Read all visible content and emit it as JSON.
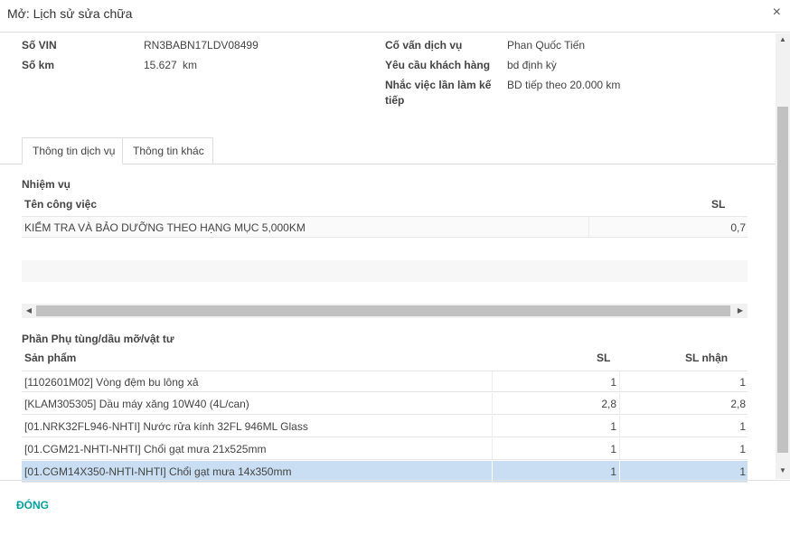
{
  "header": {
    "title": "Mở: Lịch sử sửa chữa",
    "close_symbol": "×"
  },
  "fields": {
    "vin_label": "Số VIN",
    "vin_value": "RN3BABN17LDV08499",
    "km_label": "Số km",
    "km_value": "15.627",
    "km_unit": "km",
    "advisor_label": "Cố vấn dịch vụ",
    "advisor_value": "Phan Quốc Tiến",
    "request_label": "Yêu cầu khách hàng",
    "request_value": "bd định kỳ",
    "reminder_label_line1": "Nhắc việc lần làm kế",
    "reminder_label_line2": "tiếp",
    "reminder_value": "BD tiếp theo 20.000 km"
  },
  "tabs": [
    {
      "label": "Thông tin dịch vụ",
      "active": true
    },
    {
      "label": "Thông tin khác",
      "active": false
    }
  ],
  "tasks": {
    "title": "Nhiệm vụ",
    "columns": {
      "name": "Tên công việc",
      "qty": "SL"
    },
    "rows": [
      {
        "name": "KIỂM TRA VÀ BẢO DƯỠNG THEO HẠNG MỤC 5,000KM",
        "qty": "0,7"
      }
    ]
  },
  "parts": {
    "title": "Phần Phụ tùng/dầu mỡ/vật tư",
    "columns": {
      "product": "Sản phẩm",
      "qty": "SL",
      "qty_received": "SL nhận"
    },
    "rows": [
      {
        "product": "[1102601M02] Vòng đệm bu lông xả",
        "qty": "1",
        "qty_received": "1"
      },
      {
        "product": "[KLAM305305] Dầu máy xăng 10W40 (4L/can)",
        "qty": "2,8",
        "qty_received": "2,8"
      },
      {
        "product": "[01.NRK32FL946-NHTI] Nước rửa kính 32FL 946ML Glass",
        "qty": "1",
        "qty_received": "1"
      },
      {
        "product": "[01.CGM21-NHTI-NHTI] Chổi gạt mưa 21x525mm",
        "qty": "1",
        "qty_received": "1"
      },
      {
        "product": "[01.CGM14X350-NHTI-NHTI] Chổi gạt mưa 14x350mm",
        "qty": "1",
        "qty_received": "1"
      }
    ]
  },
  "footer": {
    "close_label": "ĐÓNG"
  },
  "colors": {
    "accent": "#00a09d",
    "selected_row": "#c9def2"
  }
}
